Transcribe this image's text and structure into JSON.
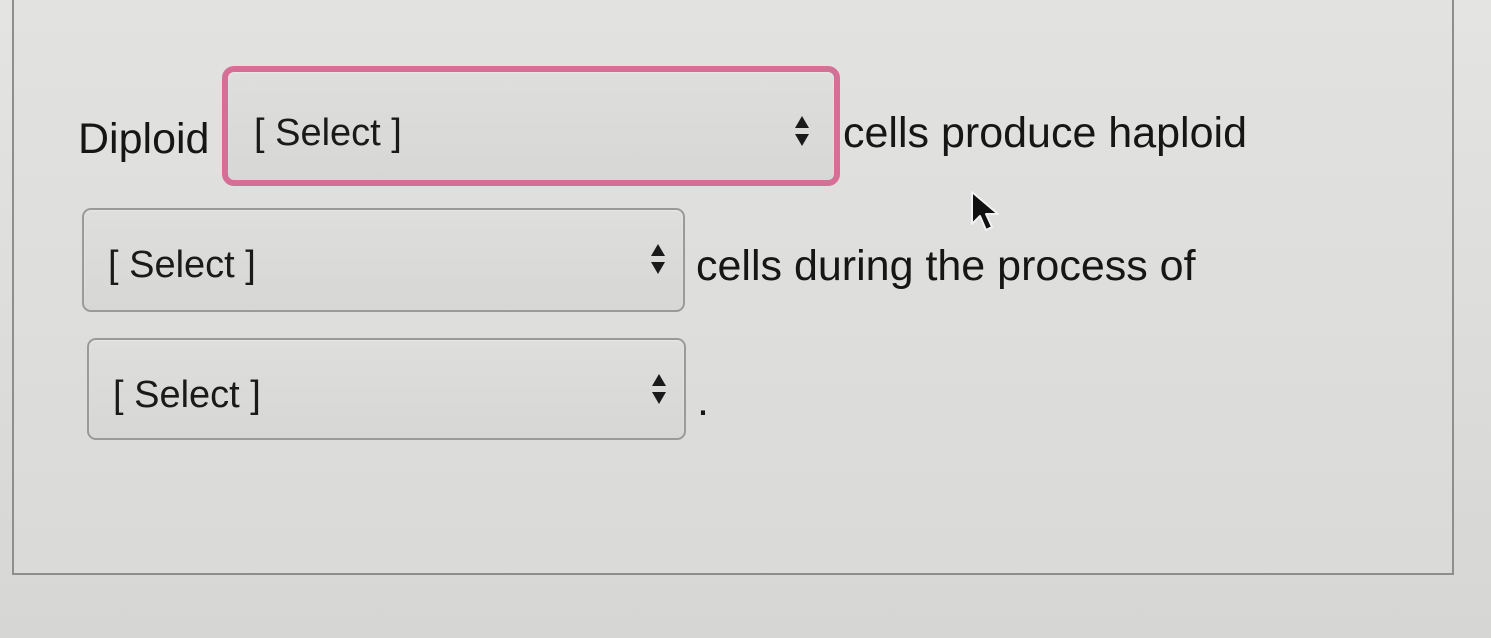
{
  "question": {
    "word_diploid": "Diploid",
    "text_after_1": "cells produce haploid",
    "text_after_2": "cells during the process of",
    "text_after_3": "."
  },
  "dropdowns": [
    {
      "selected_label": "[ Select ]",
      "icon": "sort-arrows-icon"
    },
    {
      "selected_label": "[ Select ]",
      "icon": "sort-arrows-icon"
    },
    {
      "selected_label": "[ Select ]",
      "icon": "sort-arrows-icon"
    }
  ],
  "colors": {
    "focus_ring": "#d56f95"
  }
}
